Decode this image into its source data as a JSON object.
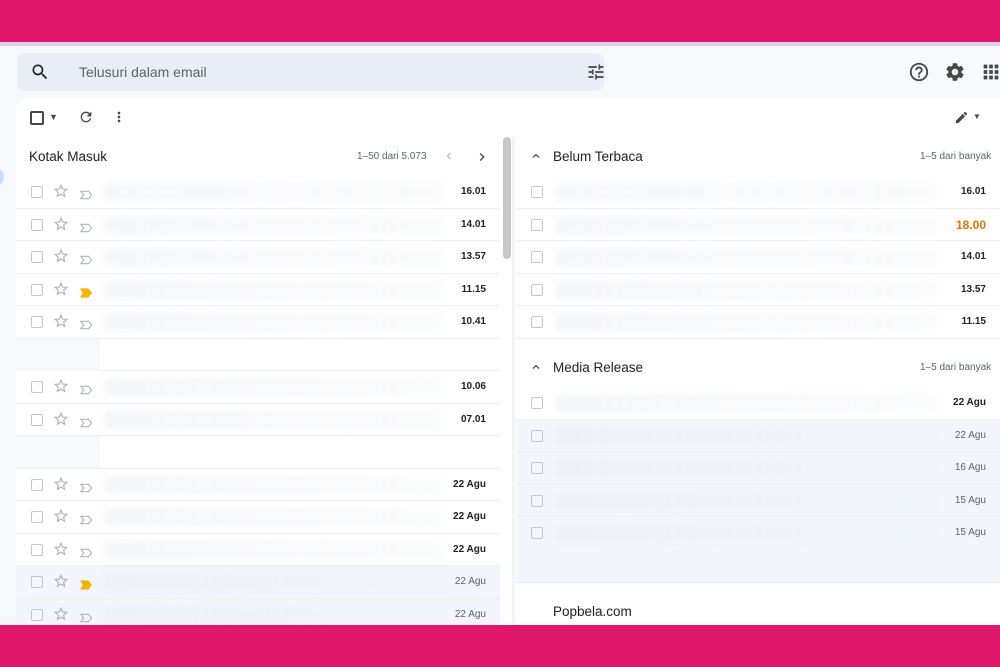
{
  "search": {
    "placeholder": "Telusuri dalam email"
  },
  "inbox": {
    "title": "Kotak Masuk",
    "count": "1–50 dari 5.073",
    "rows": [
      {
        "time": "16.01",
        "bold": true,
        "label": false
      },
      {
        "time": "14.01",
        "bold": true,
        "label": false
      },
      {
        "time": "13.57",
        "bold": true,
        "label": false
      },
      {
        "time": "11.15",
        "bold": true,
        "label": true
      },
      {
        "time": "10.41",
        "bold": true,
        "label": false
      },
      {
        "time": "",
        "bold": true,
        "label": false,
        "gap": true
      },
      {
        "time": "10.06",
        "bold": true,
        "label": false
      },
      {
        "time": "07.01",
        "bold": true,
        "label": false
      },
      {
        "time": "",
        "bold": true,
        "label": false,
        "gap": true
      },
      {
        "time": "22 Agu",
        "bold": true,
        "label": false
      },
      {
        "time": "22 Agu",
        "bold": true,
        "label": false
      },
      {
        "time": "22 Agu",
        "bold": true,
        "label": false
      },
      {
        "time": "22 Agu",
        "bold": false,
        "label": true
      },
      {
        "time": "22 Agu",
        "bold": false,
        "label": false
      }
    ]
  },
  "unread": {
    "title": "Belum Terbaca",
    "count": "1–5 dari banyak",
    "rows": [
      {
        "time": "16.01",
        "style": "b"
      },
      {
        "time": "18.00",
        "style": "o"
      },
      {
        "time": "14.01",
        "style": "b"
      },
      {
        "time": "13.57",
        "style": "b"
      },
      {
        "time": "11.15",
        "style": "b"
      }
    ]
  },
  "media": {
    "title": "Media Release",
    "count": "1–5 dari banyak",
    "rows": [
      {
        "time": "22 Agu",
        "style": "b"
      },
      {
        "time": "22 Agu",
        "style": "n"
      },
      {
        "time": "16 Agu",
        "style": "n"
      },
      {
        "time": "15 Agu",
        "style": "n"
      },
      {
        "time": "15 Agu",
        "style": "n"
      }
    ]
  },
  "popbela": {
    "title": "Popbela.com"
  },
  "colors": {
    "band": "#e0186b",
    "label_yellow": "#f4b400",
    "accent_orange": "#e37400"
  }
}
